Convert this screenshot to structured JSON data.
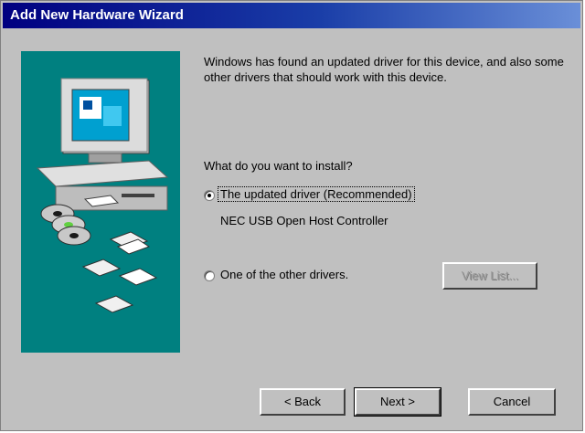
{
  "window": {
    "title": "Add New Hardware Wizard"
  },
  "content": {
    "intro": "Windows has found an updated driver for this device, and also some other drivers that should work with this device.",
    "question": "What do you want to install?",
    "options": [
      {
        "label": "The updated driver (Recommended)",
        "selected": true
      },
      {
        "label": "One of the other drivers.",
        "selected": false
      }
    ],
    "driver_name": "NEC USB Open Host Controller",
    "view_list_label": "View List..."
  },
  "buttons": {
    "back": "< Back",
    "next": "Next >",
    "cancel": "Cancel"
  },
  "colors": {
    "title_bar": "#000080",
    "panel": "#008080",
    "face": "#c0c0c0"
  },
  "icons": [
    "computer-icon",
    "cd-stack-icon",
    "floppy-disk-icon"
  ]
}
